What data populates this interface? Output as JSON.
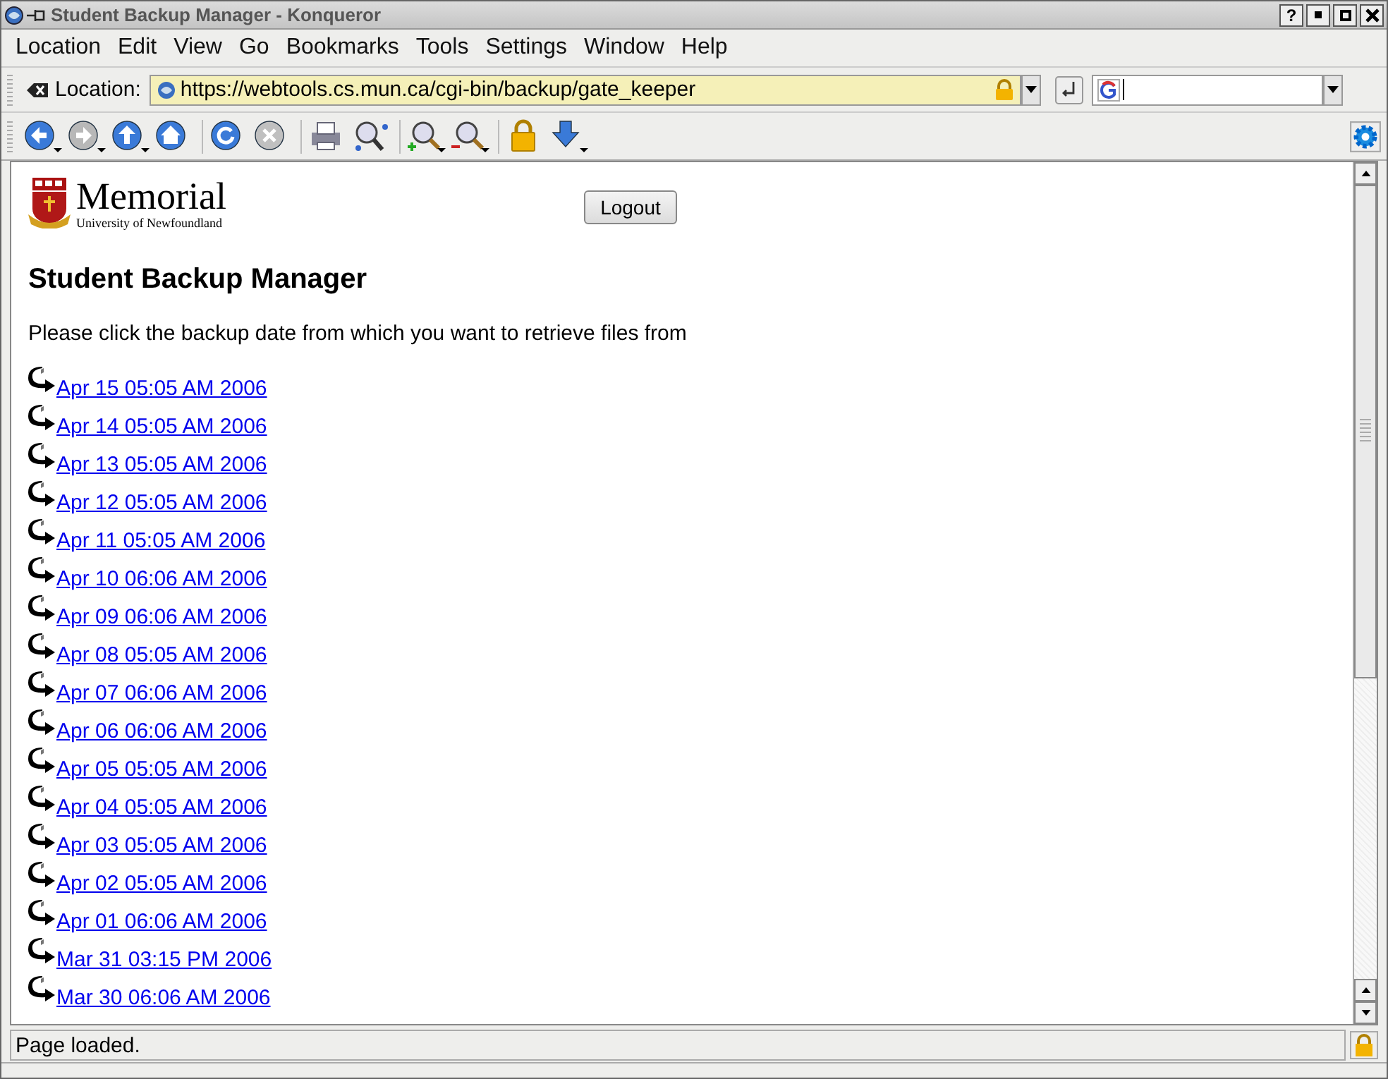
{
  "window": {
    "title": "Student Backup Manager - Konqueror",
    "help_button": "?"
  },
  "menu": [
    "Location",
    "Edit",
    "View",
    "Go",
    "Bookmarks",
    "Tools",
    "Settings",
    "Window",
    "Help"
  ],
  "location_bar": {
    "label": "Location:",
    "url": "https://webtools.cs.mun.ca/cgi-bin/backup/gate_keeper"
  },
  "page": {
    "logo": {
      "name": "Memorial",
      "subtitle": "University of Newfoundland"
    },
    "logout_button": "Logout",
    "heading": "Student Backup Manager",
    "instruction": "Please click the backup date from which you want to retrieve files from",
    "backups": [
      "Apr 15 05:05 AM 2006",
      "Apr 14 05:05 AM 2006",
      "Apr 13 05:05 AM 2006",
      "Apr 12 05:05 AM 2006",
      "Apr 11 05:05 AM 2006",
      "Apr 10 06:06 AM 2006",
      "Apr 09 06:06 AM 2006",
      "Apr 08 05:05 AM 2006",
      "Apr 07 06:06 AM 2006",
      "Apr 06 06:06 AM 2006",
      "Apr 05 05:05 AM 2006",
      "Apr 04 05:05 AM 2006",
      "Apr 03 05:05 AM 2006",
      "Apr 02 05:05 AM 2006",
      "Apr 01 06:06 AM 2006",
      "Mar 31 03:15 PM 2006",
      "Mar 30 06:06 AM 2006"
    ]
  },
  "status_bar": {
    "text": "Page loaded."
  }
}
